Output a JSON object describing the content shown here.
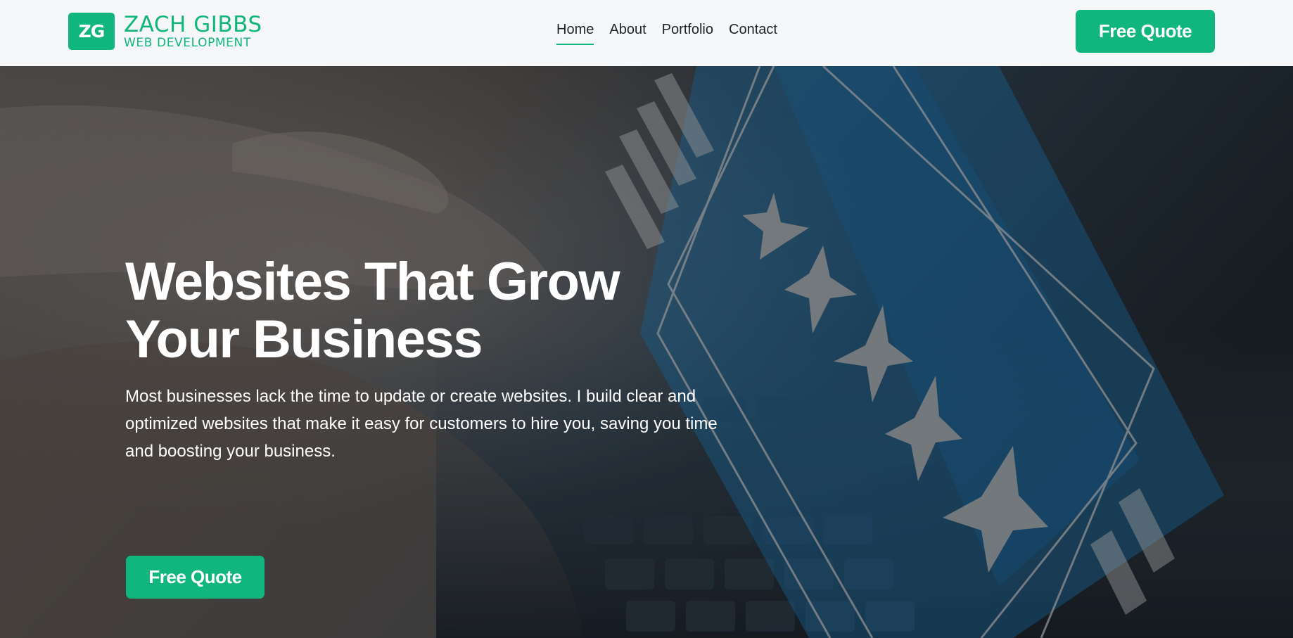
{
  "brand": {
    "mark": "ZG",
    "name": "ZACH GIBBS",
    "tagline": "WEB DEVELOPMENT",
    "color": "#10b67d"
  },
  "nav": {
    "items": [
      {
        "label": "Home",
        "active": true
      },
      {
        "label": "About",
        "active": false
      },
      {
        "label": "Portfolio",
        "active": false
      },
      {
        "label": "Contact",
        "active": false
      }
    ]
  },
  "header": {
    "cta_label": "Free Quote"
  },
  "hero": {
    "title": "Websites That Grow Your Business",
    "description": "Most businesses lack the time to update or create websites. I build clear and optimized websites that make it easy for customers to hire you, saving you time and boosting your business.",
    "cta_label": "Free Quote",
    "background_image": "hands-typing-on-laptop-with-rating-stars-overlay"
  },
  "colors": {
    "accent": "#10b67d",
    "header_bg": "#f5f7f9",
    "hero_text": "#ffffff"
  }
}
